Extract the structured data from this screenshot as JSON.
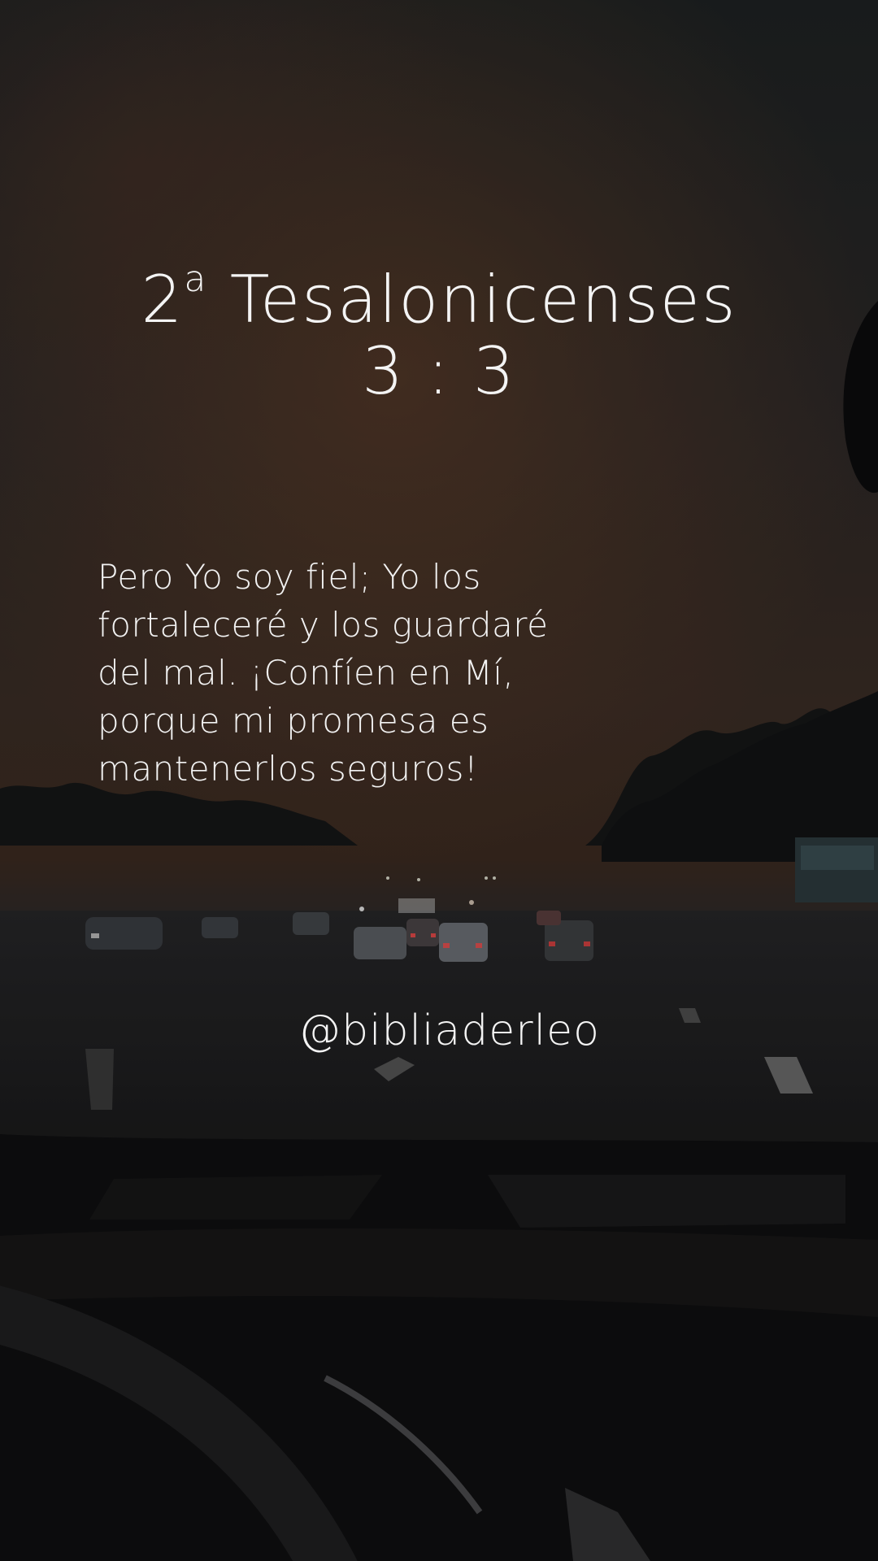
{
  "post": {
    "title_book": "2",
    "title_ordinal": "a",
    "title_name": "Tesalonicenses",
    "title_ref": "3 : 3",
    "verse_lines": [
      "Pero Yo soy fiel; Yo los",
      "fortaleceré y los guardaré",
      "del mal. ¡Confíen en Mí,",
      "porque mi promesa es",
      "mantenerlos seguros!"
    ],
    "handle": "@bibliaderleo"
  },
  "background": {
    "description_icon": "dusk-highway-car-interior-photo",
    "sky_color": "#2a2624",
    "glow_color": "#6a3c20",
    "dash_color": "#0b0b0c"
  }
}
